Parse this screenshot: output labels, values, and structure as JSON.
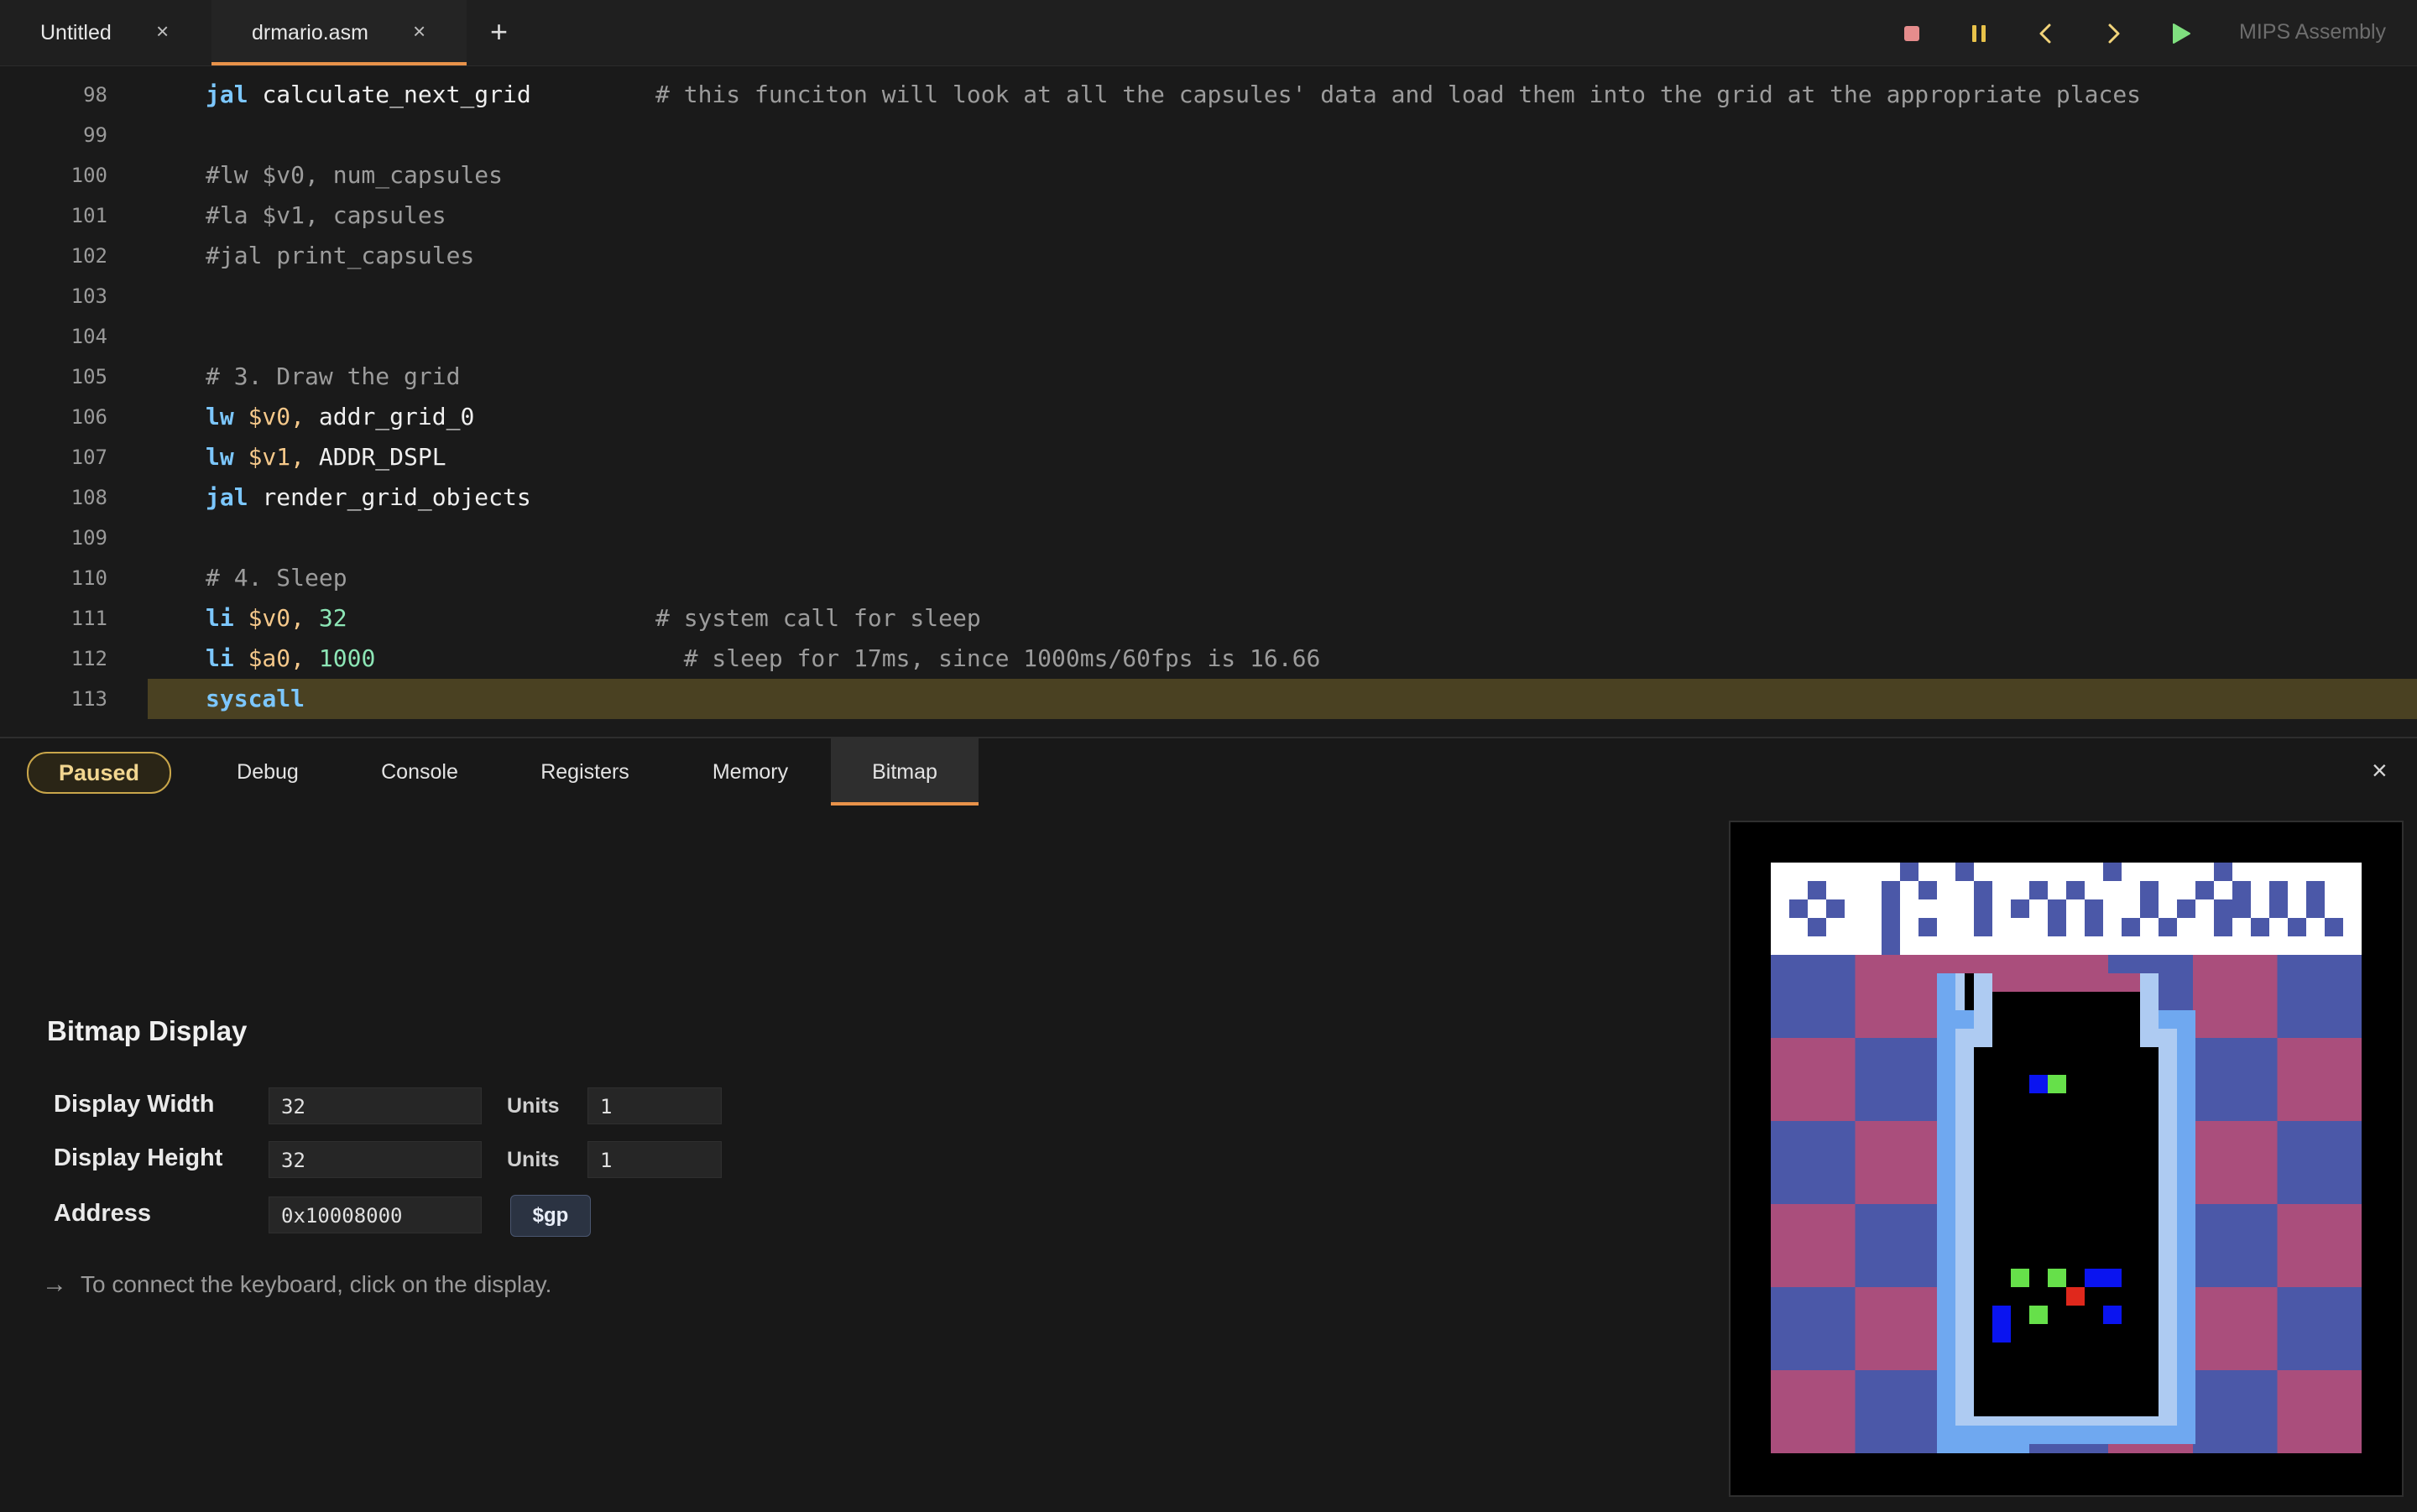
{
  "tabs": [
    {
      "label": "Untitled",
      "close": "×",
      "active": false
    },
    {
      "label": "drmario.asm",
      "close": "×",
      "active": true
    }
  ],
  "new_tab_icon": "+",
  "controls": {
    "stop_icon": "stop-icon",
    "pause_icon": "pause-icon",
    "step_back_icon": "chevron-left-icon",
    "step_forward_icon": "chevron-right-icon",
    "run_icon": "play-icon",
    "stop_color": "#e58c8c",
    "pause_color": "#e8c24a",
    "nav_color": "#f2d47a",
    "run_color": "#7fe07f"
  },
  "language": "MIPS Assembly",
  "editor": {
    "highlight_color": "#4a4122",
    "lines": [
      {
        "n": "98",
        "kw": "jal",
        "reg": "",
        "rest": "calculate_next_grid",
        "num": "",
        "comment": "# this funciton will look at all the capsules' data and load them into the grid at the appropriate places"
      },
      {
        "n": "99",
        "kw": "",
        "reg": "",
        "rest": "",
        "num": "",
        "comment": ""
      },
      {
        "n": "100",
        "kw": "",
        "reg": "",
        "rest": "#lw $v0, num_capsules",
        "num": "",
        "comment": ""
      },
      {
        "n": "101",
        "kw": "",
        "reg": "",
        "rest": "#la $v1, capsules",
        "num": "",
        "comment": ""
      },
      {
        "n": "102",
        "kw": "",
        "reg": "",
        "rest": "#jal print_capsules",
        "num": "",
        "comment": ""
      },
      {
        "n": "103",
        "kw": "",
        "reg": "",
        "rest": "",
        "num": "",
        "comment": ""
      },
      {
        "n": "104",
        "kw": "",
        "reg": "",
        "rest": "",
        "num": "",
        "comment": ""
      },
      {
        "n": "105",
        "kw": "",
        "reg": "",
        "rest": "# 3. Draw the grid",
        "num": "",
        "comment": ""
      },
      {
        "n": "106",
        "kw": "lw",
        "reg": "$v0,",
        "rest": "addr_grid_0",
        "num": "",
        "comment": ""
      },
      {
        "n": "107",
        "kw": "lw",
        "reg": "$v1,",
        "rest": "ADDR_DSPL",
        "num": "",
        "comment": ""
      },
      {
        "n": "108",
        "kw": "jal",
        "reg": "",
        "rest": "render_grid_objects",
        "num": "",
        "comment": ""
      },
      {
        "n": "109",
        "kw": "",
        "reg": "",
        "rest": "",
        "num": "",
        "comment": ""
      },
      {
        "n": "110",
        "kw": "",
        "reg": "",
        "rest": "# 4. Sleep",
        "num": "",
        "comment": ""
      },
      {
        "n": "111",
        "kw": "li",
        "reg": "$v0,",
        "rest": "",
        "num": "32",
        "comment": "# system call for sleep"
      },
      {
        "n": "112",
        "kw": "li",
        "reg": "$a0,",
        "rest": "",
        "num": "1000",
        "comment": "  # sleep for 17ms, since 1000ms/60fps is 16.66"
      },
      {
        "n": "113",
        "kw": "syscall",
        "reg": "",
        "rest": "",
        "num": "",
        "comment": ""
      }
    ],
    "highlighted_line": "113"
  },
  "panel": {
    "status": "Paused",
    "tabs": [
      "Debug",
      "Console",
      "Registers",
      "Memory",
      "Bitmap"
    ],
    "active_tab": "Bitmap",
    "close": "×"
  },
  "bitmap": {
    "title": "Bitmap Display",
    "width_label": "Display Width",
    "width_value": "32",
    "height_label": "Display Height",
    "height_value": "32",
    "units_label": "Units",
    "width_units": "1",
    "height_units": "1",
    "address_label": "Address",
    "address_value": "0x10008000",
    "gp_button": "$gp",
    "hint": "To connect the keyboard, click on the display.",
    "colors": {
      "blue_check": "#4b58a8",
      "pink_check": "#aa4e7c",
      "white": "#ffffff",
      "bottle_outer": "#6fa8f0",
      "bottle_inner": "#aecbf2",
      "cap": "#aa4e7c",
      "virus_green": "#66e04a",
      "capsule_blue": "#0a14f0",
      "capsule_red": "#e0281c",
      "black": "#000000"
    }
  }
}
